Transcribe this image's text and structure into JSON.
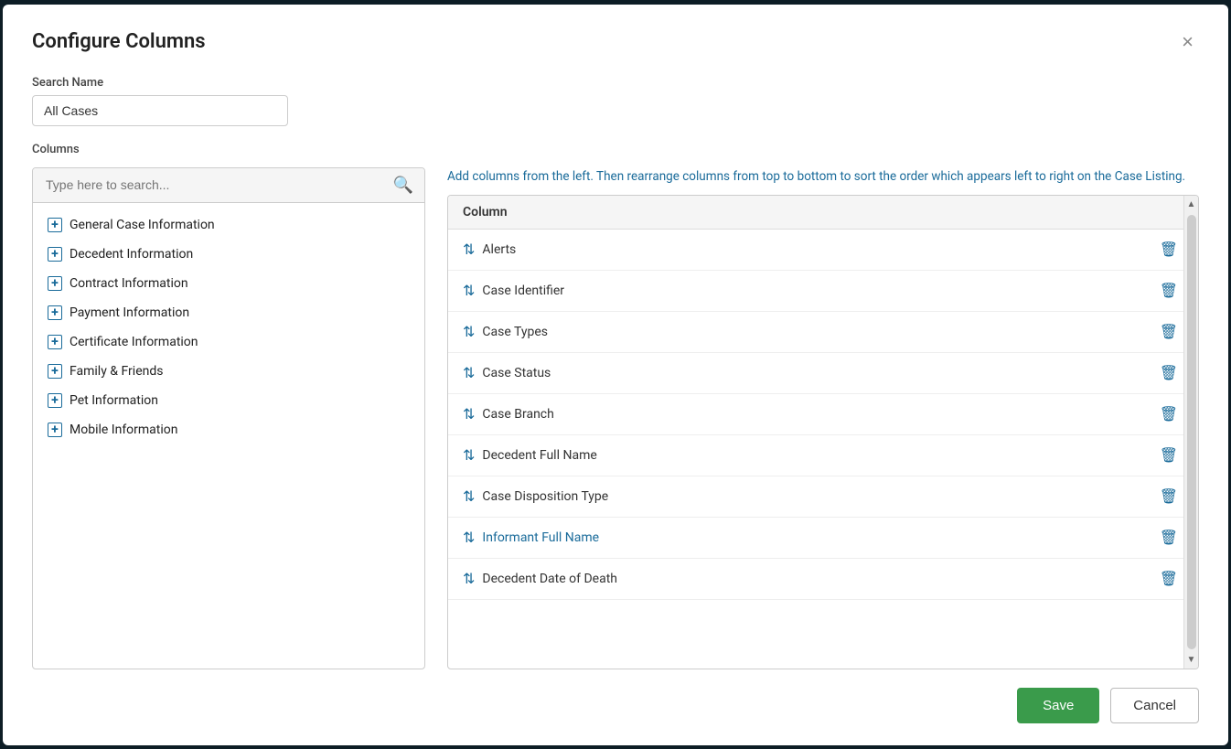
{
  "modal": {
    "title": "Configure Columns",
    "close_label": "×"
  },
  "search_name": {
    "label": "Search Name",
    "value": "All Cases",
    "placeholder": "All Cases"
  },
  "columns_label": "Columns",
  "search_placeholder": "Type here to search...",
  "instruction": "Add columns from the left. Then rearrange columns from top to bottom to sort the order which appears left to right on the Case Listing.",
  "tree_items": [
    {
      "id": "general-case-info",
      "label": "General Case Information"
    },
    {
      "id": "decedent-info",
      "label": "Decedent Information"
    },
    {
      "id": "contract-info",
      "label": "Contract Information"
    },
    {
      "id": "payment-info",
      "label": "Payment Information"
    },
    {
      "id": "certificate-info",
      "label": "Certificate Information"
    },
    {
      "id": "family-friends",
      "label": "Family & Friends"
    },
    {
      "id": "pet-info",
      "label": "Pet Information"
    },
    {
      "id": "mobile-info",
      "label": "Mobile Information"
    }
  ],
  "table": {
    "column_header": "Column",
    "rows": [
      {
        "name": "Alerts",
        "highlighted": false
      },
      {
        "name": "Case Identifier",
        "highlighted": false
      },
      {
        "name": "Case Types",
        "highlighted": false
      },
      {
        "name": "Case Status",
        "highlighted": false
      },
      {
        "name": "Case Branch",
        "highlighted": false
      },
      {
        "name": "Decedent Full Name",
        "highlighted": false
      },
      {
        "name": "Case Disposition Type",
        "highlighted": false
      },
      {
        "name": "Informant Full Name",
        "highlighted": true
      },
      {
        "name": "Decedent Date of Death",
        "highlighted": false
      }
    ]
  },
  "footer": {
    "save_label": "Save",
    "cancel_label": "Cancel"
  }
}
